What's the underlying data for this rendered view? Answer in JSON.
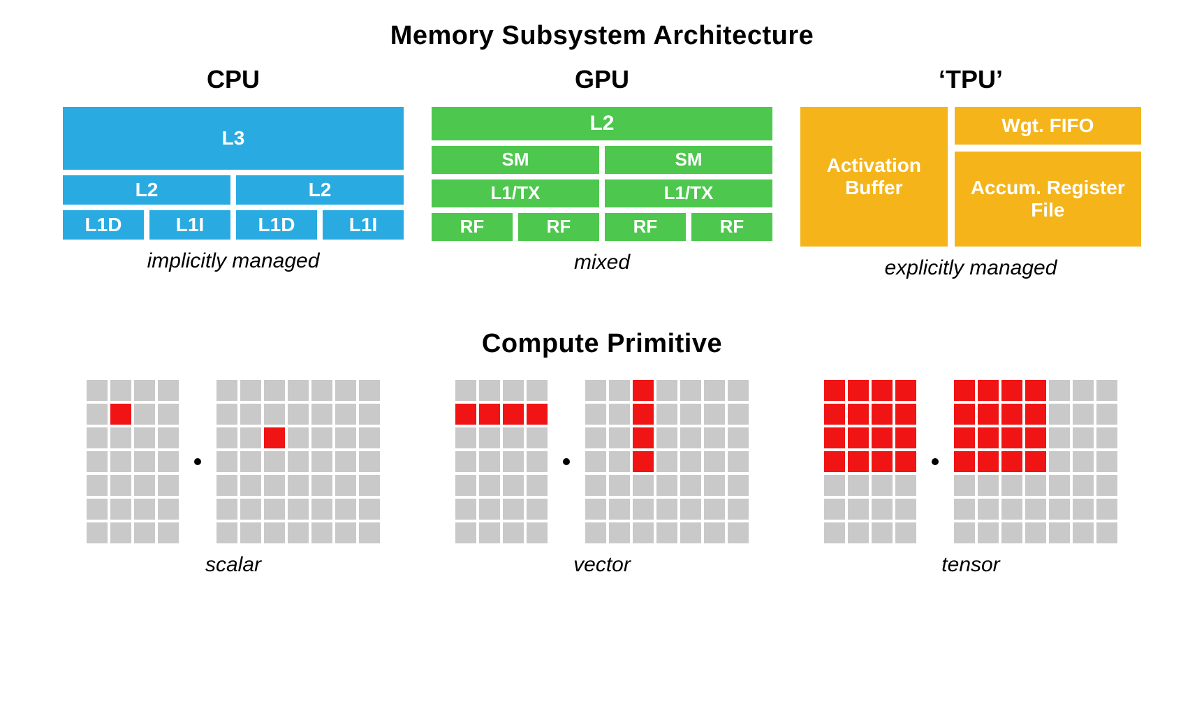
{
  "sections": {
    "memory_title": "Memory Subsystem Architecture",
    "compute_title": "Compute  Primitive"
  },
  "memory": {
    "cpu": {
      "title": "CPU",
      "l3": "L3",
      "l2": "L2",
      "l1d": "L1D",
      "l1i": "L1I",
      "caption": "implicitly managed",
      "color": "#29abe2"
    },
    "gpu": {
      "title": "GPU",
      "l2": "L2",
      "sm": "SM",
      "l1tx": "L1/TX",
      "rf": "RF",
      "caption": "mixed",
      "color": "#4dc74d"
    },
    "tpu": {
      "title": "‘TPU’",
      "activation": "Activation Buffer",
      "fifo": "Wgt. FIFO",
      "acc": "Accum. Register File",
      "caption": "explicitly managed",
      "color": "#f4b41a"
    }
  },
  "compute": {
    "scalar": {
      "label": "scalar",
      "left": {
        "rows": 7,
        "cols": 4,
        "red_cells": [
          [
            1,
            1
          ]
        ]
      },
      "right": {
        "rows": 7,
        "cols": 7,
        "red_cells": [
          [
            2,
            2
          ]
        ]
      }
    },
    "vector": {
      "label": "vector",
      "left": {
        "rows": 7,
        "cols": 4,
        "red_cells": [
          [
            1,
            0
          ],
          [
            1,
            1
          ],
          [
            1,
            2
          ],
          [
            1,
            3
          ]
        ]
      },
      "right": {
        "rows": 7,
        "cols": 7,
        "red_cells": [
          [
            0,
            2
          ],
          [
            1,
            2
          ],
          [
            2,
            2
          ],
          [
            3,
            2
          ]
        ]
      }
    },
    "tensor": {
      "label": "tensor",
      "left": {
        "rows": 7,
        "cols": 4,
        "red_cells": [
          [
            0,
            0
          ],
          [
            0,
            1
          ],
          [
            0,
            2
          ],
          [
            0,
            3
          ],
          [
            1,
            0
          ],
          [
            1,
            1
          ],
          [
            1,
            2
          ],
          [
            1,
            3
          ],
          [
            2,
            0
          ],
          [
            2,
            1
          ],
          [
            2,
            2
          ],
          [
            2,
            3
          ],
          [
            3,
            0
          ],
          [
            3,
            1
          ],
          [
            3,
            2
          ],
          [
            3,
            3
          ]
        ]
      },
      "right": {
        "rows": 7,
        "cols": 7,
        "red_cells": [
          [
            0,
            0
          ],
          [
            0,
            1
          ],
          [
            0,
            2
          ],
          [
            0,
            3
          ],
          [
            1,
            0
          ],
          [
            1,
            1
          ],
          [
            1,
            2
          ],
          [
            1,
            3
          ],
          [
            2,
            0
          ],
          [
            2,
            1
          ],
          [
            2,
            2
          ],
          [
            2,
            3
          ],
          [
            3,
            0
          ],
          [
            3,
            1
          ],
          [
            3,
            2
          ],
          [
            3,
            3
          ]
        ]
      }
    }
  }
}
